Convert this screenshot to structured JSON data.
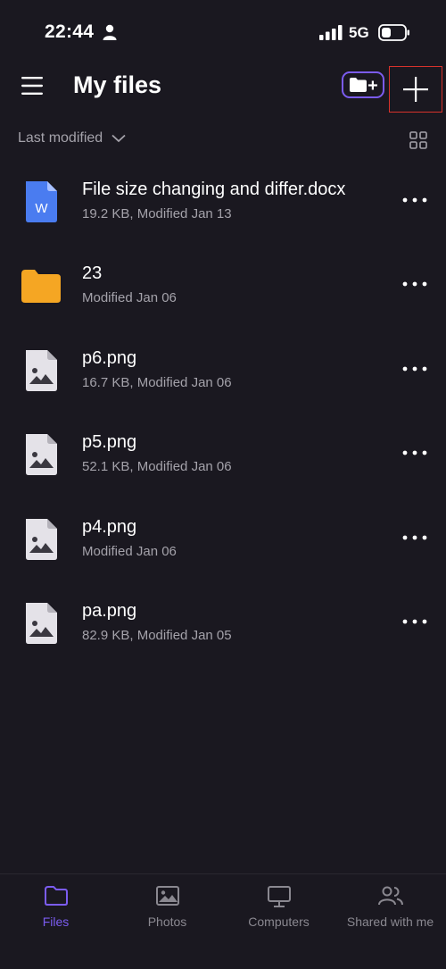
{
  "status_bar": {
    "time": "22:44",
    "network": "5G"
  },
  "header": {
    "title": "My files"
  },
  "sort": {
    "label": "Last modified"
  },
  "files": [
    {
      "name": "File size changing and differ.docx",
      "meta": "19.2 KB, Modified Jan 13",
      "type": "word"
    },
    {
      "name": "23",
      "meta": "Modified Jan 06",
      "type": "folder"
    },
    {
      "name": "p6.png",
      "meta": "16.7 KB, Modified Jan 06",
      "type": "image"
    },
    {
      "name": "p5.png",
      "meta": "52.1 KB, Modified Jan 06",
      "type": "image"
    },
    {
      "name": "p4.png",
      "meta": "Modified Jan 06",
      "type": "image"
    },
    {
      "name": "pa.png",
      "meta": "82.9 KB, Modified Jan 05",
      "type": "image"
    }
  ],
  "nav": [
    {
      "label": "Files",
      "icon": "folder-icon",
      "active": true
    },
    {
      "label": "Photos",
      "icon": "photo-icon",
      "active": false
    },
    {
      "label": "Computers",
      "icon": "monitor-icon",
      "active": false
    },
    {
      "label": "Shared with me",
      "icon": "people-icon",
      "active": false
    }
  ],
  "colors": {
    "accent": "#7b5cf0",
    "background": "#1a1820",
    "folder": "#f5a623",
    "word": "#4a7cf0",
    "highlight": "#d8322c"
  },
  "word_icon_letter": "W"
}
